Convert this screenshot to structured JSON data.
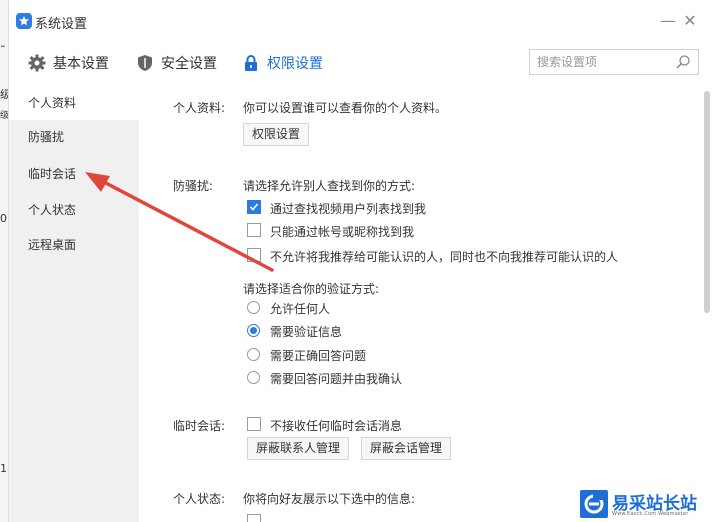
{
  "window": {
    "title": "系统设置",
    "minimize": "—",
    "close": "✕"
  },
  "left_edge": {
    "chars": [
      "˜",
      "级",
      "级",
      "01",
      "1"
    ]
  },
  "tabs": [
    {
      "label": "基本设置",
      "icon": "gear-icon"
    },
    {
      "label": "安全设置",
      "icon": "shield-icon"
    },
    {
      "label": "权限设置",
      "icon": "lock-icon"
    }
  ],
  "search": {
    "placeholder": "搜索设置项",
    "value": ""
  },
  "sidebar": {
    "items": [
      {
        "label": "个人资料"
      },
      {
        "label": "防骚扰"
      },
      {
        "label": "临时会话"
      },
      {
        "label": "个人状态"
      },
      {
        "label": "远程桌面"
      }
    ]
  },
  "profile": {
    "label": "个人资料:",
    "desc": "你可以设置谁可以查看你的个人资料。",
    "button": "权限设置"
  },
  "anti_harass": {
    "label": "防骚扰:",
    "find_prompt": "请选择允许别人查找到你的方式:",
    "find_options": [
      {
        "label": "通过查找视频用户列表找到我",
        "checked": true
      },
      {
        "label": "只能通过帐号或昵称找到我",
        "checked": false
      },
      {
        "label": "不允许将我推荐给可能认识的人，同时也不向我推荐可能认识的人",
        "checked": false
      }
    ],
    "verify_prompt": "请选择适合你的验证方式:",
    "verify_options": [
      {
        "label": "允许任何人",
        "selected": false
      },
      {
        "label": "需要验证信息",
        "selected": true
      },
      {
        "label": "需要正确回答问题",
        "selected": false
      },
      {
        "label": "需要回答问题并由我确认",
        "selected": false
      }
    ]
  },
  "temp_session": {
    "label": "临时会话:",
    "option": {
      "label": "不接收任何临时会话消息",
      "checked": false
    },
    "button_contacts": "屏蔽联系人管理",
    "button_sessions": "屏蔽会话管理"
  },
  "status": {
    "label": "个人状态:",
    "desc": "你将向好友展示以下选中的信息:"
  },
  "watermark": {
    "title": "易采站长站",
    "subtitle": "Www.Easck.Com Webmaster"
  },
  "colors": {
    "accent": "#1d6fd3",
    "sidebar_bg": "#f0f0f0",
    "arrow": "#e0473a"
  }
}
